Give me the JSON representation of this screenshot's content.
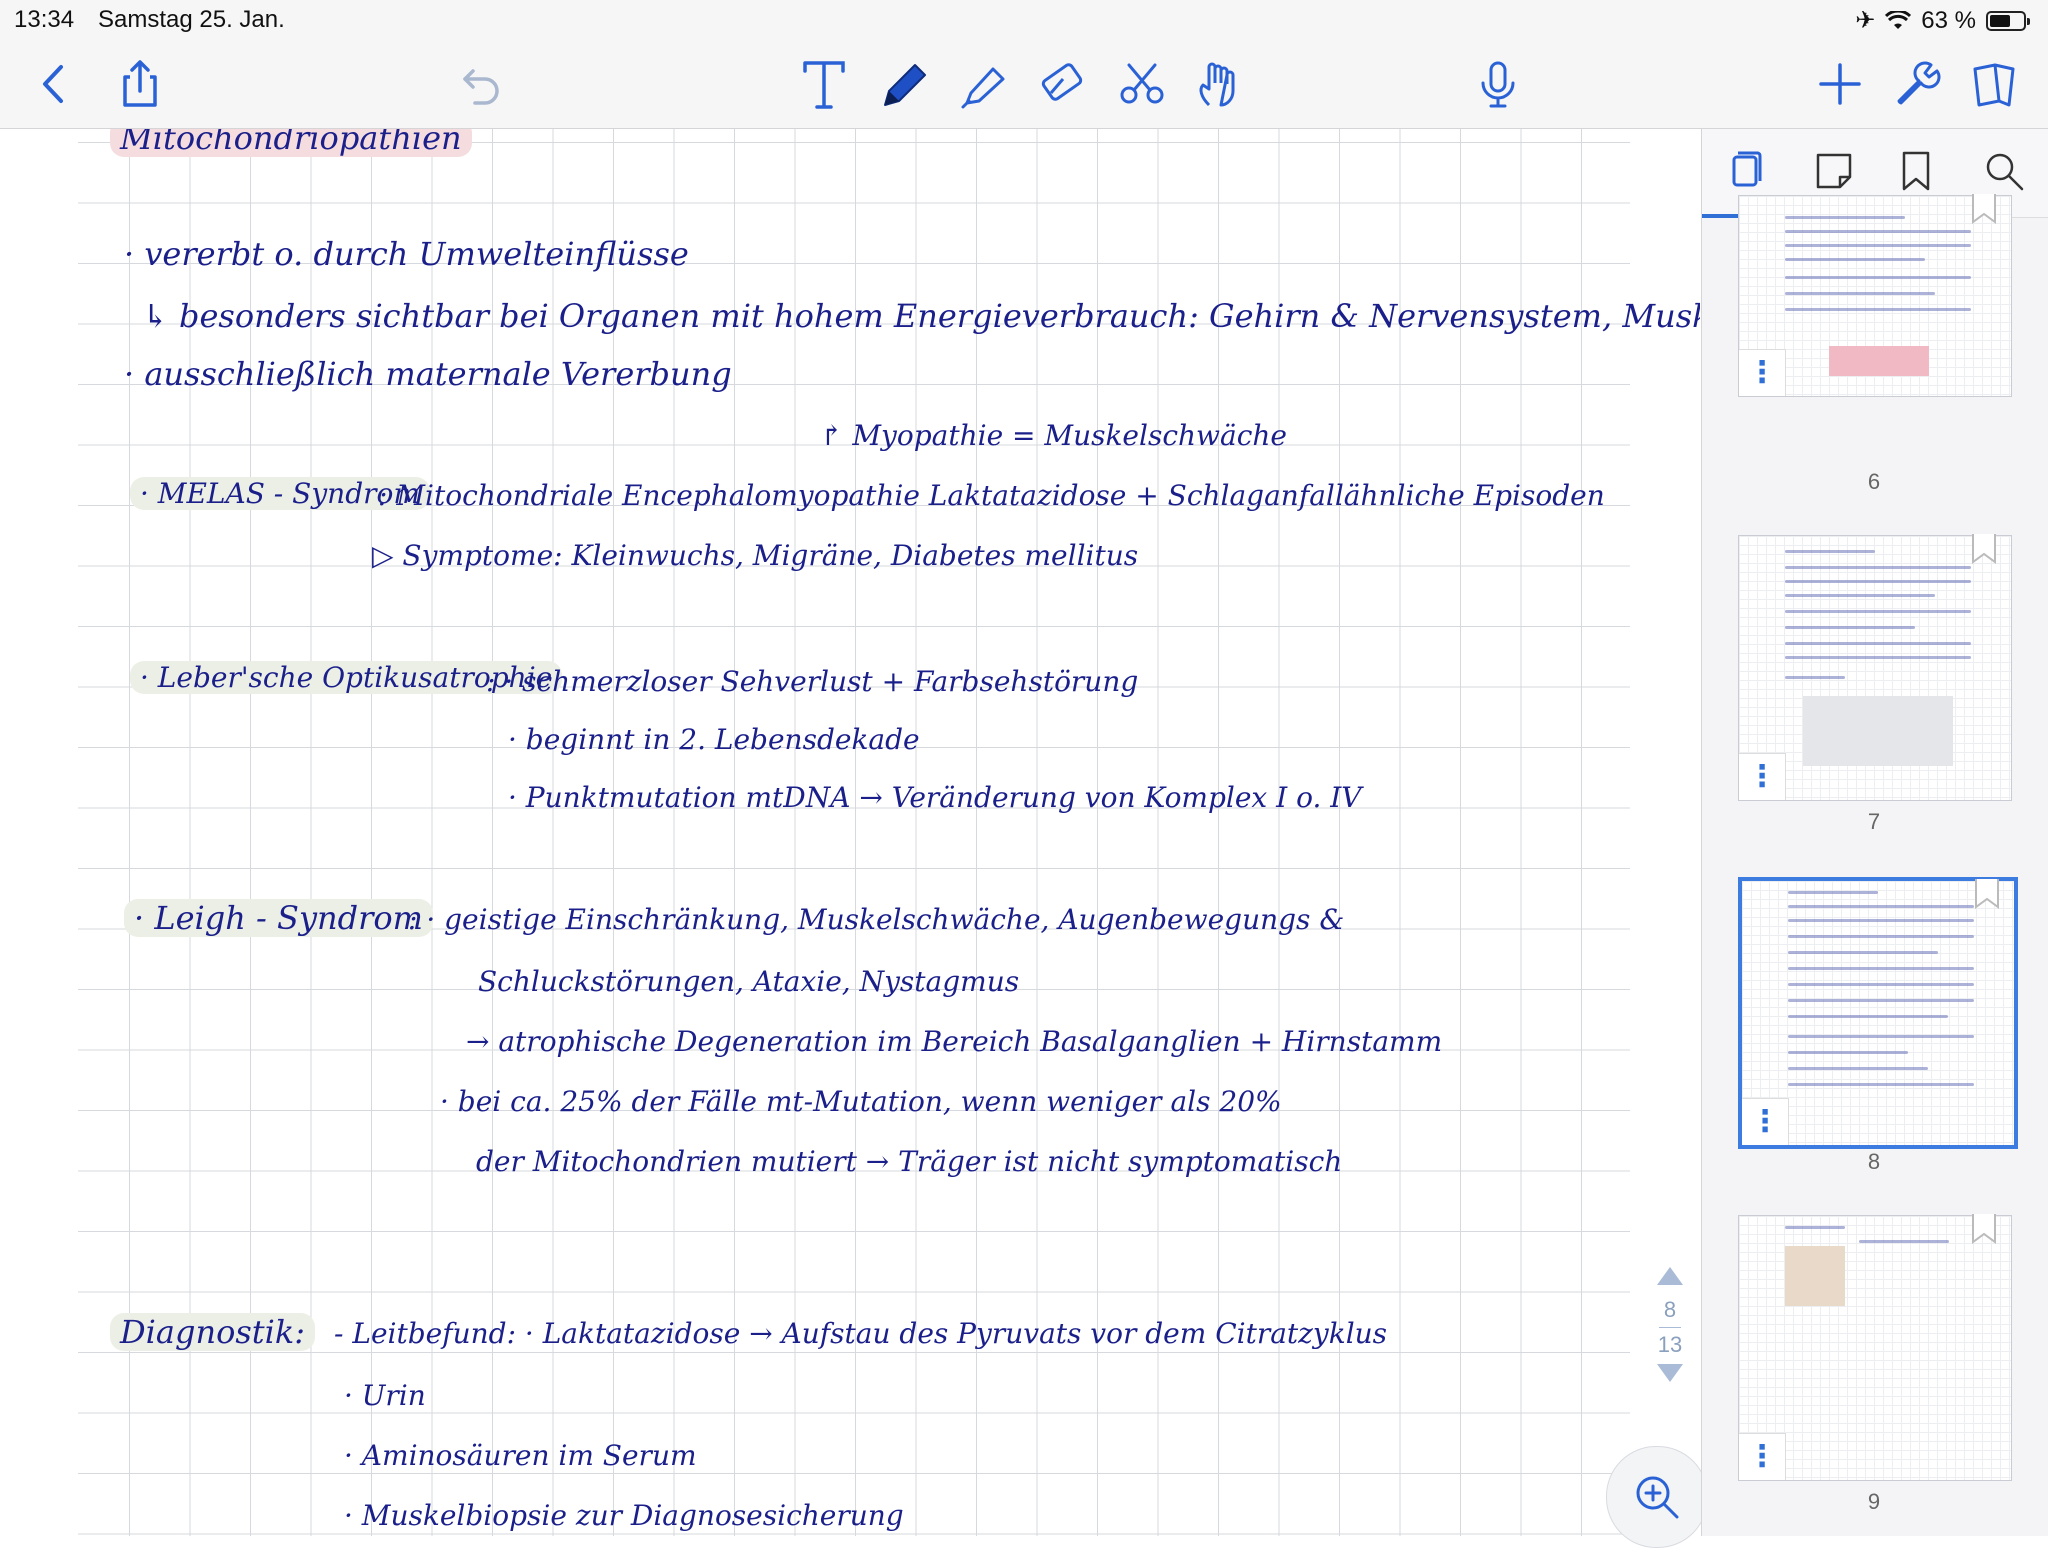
{
  "status": {
    "time": "13:34",
    "date": "Samstag 25. Jan.",
    "battery": "63 %",
    "battery_level": 0.63
  },
  "toolbar": {
    "icons": [
      "back-icon",
      "share-icon",
      "undo-icon",
      "text-tool-icon",
      "pen-tool-icon",
      "highlighter-tool-icon",
      "eraser-tool-icon",
      "scissors-tool-icon",
      "hand-tool-icon",
      "microphone-icon",
      "add-icon",
      "settings-wrench-icon",
      "pages-icon"
    ],
    "accent": "#1f4fc4"
  },
  "note": {
    "lines": [
      "Mitochondriopathien",
      "· vererbt o. durch Umwelteinflüsse",
      "↳ besonders sichtbar bei Organen mit hohem Energieverbrauch: Gehirn & Nervensystem, Muskeln ...",
      "· ausschließlich maternale Vererbung",
      "↱ Myopathie = Muskelschwäche",
      "· MELAS - Syndrom",
      ": Mitochondriale Encephalomyopathie Laktatazidose + Schlaganfallähnliche Episoden",
      "▷ Symptome: Kleinwuchs, Migräne, Diabetes mellitus",
      "· Leber'sche Optikusatrophie",
      ": · schmerzloser Sehverlust + Farbsehstörung",
      "· beginnt in 2. Lebensdekade",
      "· Punktmutation mtDNA → Veränderung von Komplex I o. IV",
      "· Leigh - Syndrom",
      ": · geistige Einschränkung, Muskelschwäche, Augenbewegungs &",
      "Schluckstörungen, Ataxie, Nystagmus",
      "→ atrophische Degeneration im Bereich Basalganglien + Hirnstamm",
      "· bei ca. 25% der Fälle mt-Mutation, wenn weniger als 20%",
      "der Mitochondrien mutiert → Träger ist nicht symptomatisch",
      "Diagnostik:",
      "- Leitbefund: · Laktatazidose → Aufstau des Pyruvats vor dem Citratzyklus",
      "· Urin",
      "· Aminosäuren im Serum",
      "· Muskelbiopsie zur Diagnosesicherung"
    ]
  },
  "pagenav": {
    "current": "8",
    "total": "13"
  },
  "sidebar": {
    "tabs": [
      "pages-tab-icon",
      "outline-tab-icon",
      "bookmark-tab-icon",
      "search-tab-icon"
    ],
    "thumbnails": [
      {
        "page": "6",
        "active": false
      },
      {
        "page": "7",
        "active": false
      },
      {
        "page": "8",
        "active": true
      },
      {
        "page": "9",
        "active": false
      }
    ]
  }
}
